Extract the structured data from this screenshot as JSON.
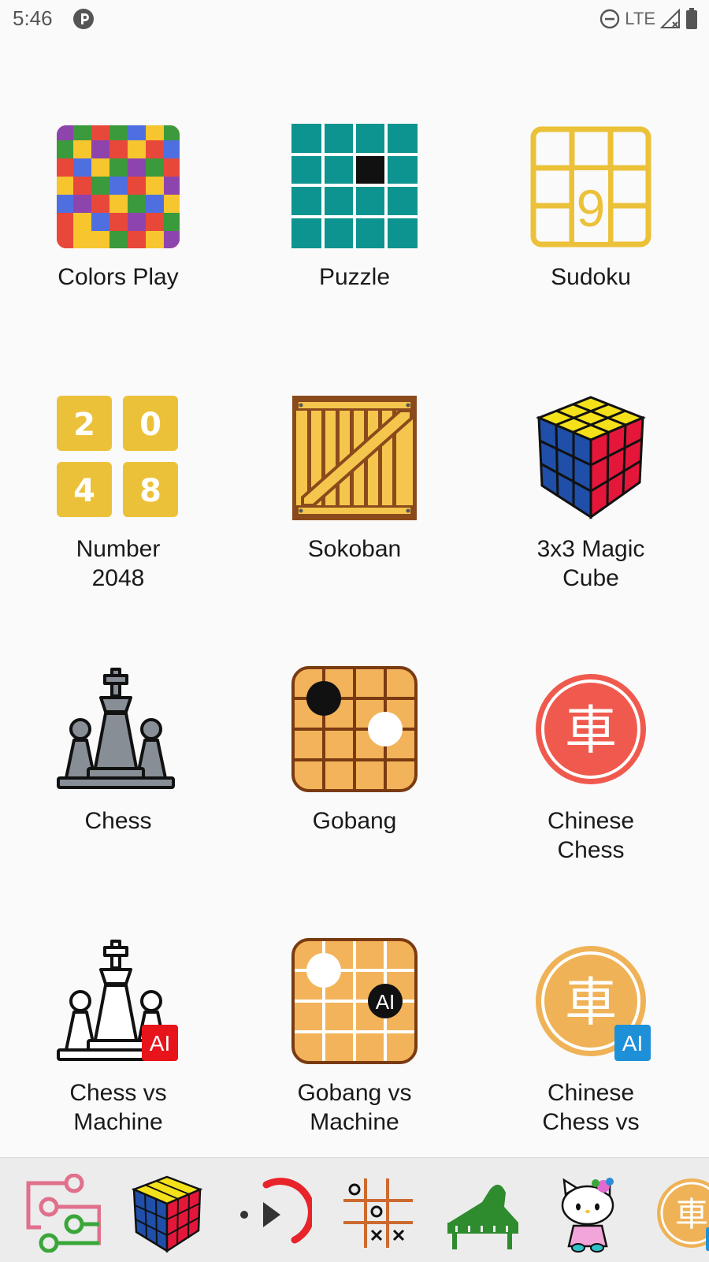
{
  "status_bar": {
    "time": "5:46",
    "network": "LTE"
  },
  "games": [
    {
      "label": "Colors Play",
      "icon": "colors-play-icon"
    },
    {
      "label": "Puzzle",
      "icon": "puzzle-grid-icon"
    },
    {
      "label": "Sudoku",
      "icon": "sudoku-icon"
    },
    {
      "label": "Number\n2048",
      "icon": "number-2048-icon"
    },
    {
      "label": "Sokoban",
      "icon": "sokoban-crate-icon"
    },
    {
      "label": "3x3 Magic\nCube",
      "icon": "magic-cube-icon"
    },
    {
      "label": "Chess",
      "icon": "chess-icon"
    },
    {
      "label": "Gobang",
      "icon": "gobang-icon"
    },
    {
      "label": "Chinese\nChess",
      "icon": "chinese-chess-icon"
    },
    {
      "label": "Chess vs\nMachine",
      "icon": "chess-ai-icon"
    },
    {
      "label": "Gobang vs\nMachine",
      "icon": "gobang-ai-icon"
    },
    {
      "label": "Chinese\nChess vs",
      "icon": "chinese-chess-ai-icon"
    }
  ],
  "icon_text": {
    "sudoku_digit": "9",
    "tiles_2048": [
      "2",
      "0",
      "4",
      "8"
    ],
    "chinese_char": "車",
    "ai_badge": "AI"
  },
  "dock": [
    {
      "icon": "circuit-app-icon"
    },
    {
      "icon": "magic-cube-icon"
    },
    {
      "icon": "media-play-icon"
    },
    {
      "icon": "tic-tac-toe-icon"
    },
    {
      "icon": "piano-icon"
    },
    {
      "icon": "hello-kitty-icon"
    },
    {
      "icon": "chinese-chess-ai-icon"
    }
  ],
  "colors": {
    "teal": "#0e9490",
    "gold": "#ecc13a",
    "board": "#f2b35a",
    "board_line": "#7a3b12",
    "red": "#f05a4e",
    "ai_red": "#e8141b",
    "ai_blue": "#1e90d8"
  }
}
